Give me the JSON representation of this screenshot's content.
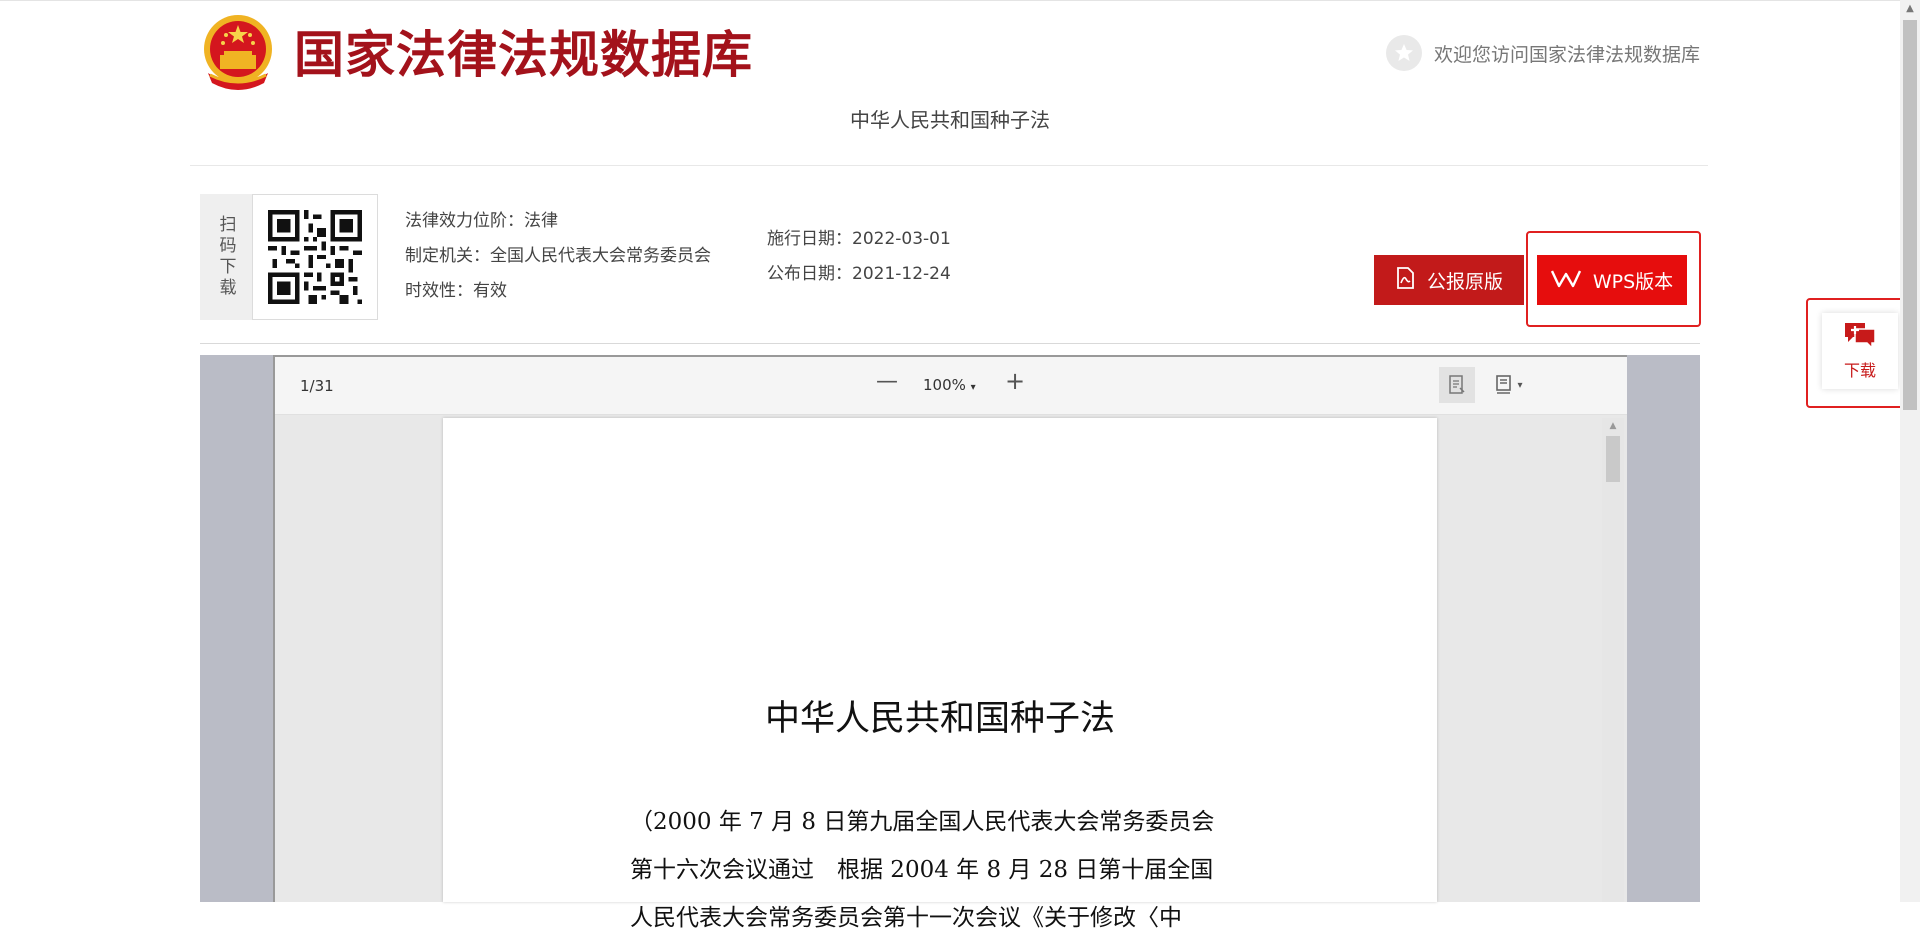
{
  "header": {
    "site_title": "国家法律法规数据库",
    "welcome": "欢迎您访问国家法律法规数据库",
    "law_subtitle": "中华人民共和国种子法"
  },
  "qr": {
    "label": "扫码下载"
  },
  "meta": {
    "level_label": "法律效力位阶：",
    "level_value": "法律",
    "authority_label": "制定机关：",
    "authority_value": "全国人民代表大会常务委员会",
    "validity_label": "时效性：",
    "validity_value": "有效",
    "effective_label": "施行日期：",
    "effective_value": "2022-03-01",
    "publish_label": "公布日期：",
    "publish_value": "2021-12-24"
  },
  "buttons": {
    "gongbao": "公报原版",
    "wps": "WPS版本",
    "float_download": "下载"
  },
  "viewer": {
    "page_count": "1/31",
    "zoom": "100%",
    "doc_title": "中华人民共和国种子法",
    "doc_lines": [
      "（2000 年 7 月 8 日第九届全国人民代表大会常务委员会",
      "第十六次会议通过　根据 2004 年 8 月 28 日第十届全国",
      "人民代表大会常务委员会第十一次会议《关于修改〈中"
    ]
  },
  "colors": {
    "brand_red": "#a3121b",
    "button_red": "#e60d0d",
    "highlight_red": "#e02020"
  },
  "icons": {
    "emblem": "national-emblem-icon",
    "star": "star-icon",
    "pdf": "pdf-icon",
    "wps": "wps-icon",
    "chat_download": "chat-plus-icon"
  }
}
